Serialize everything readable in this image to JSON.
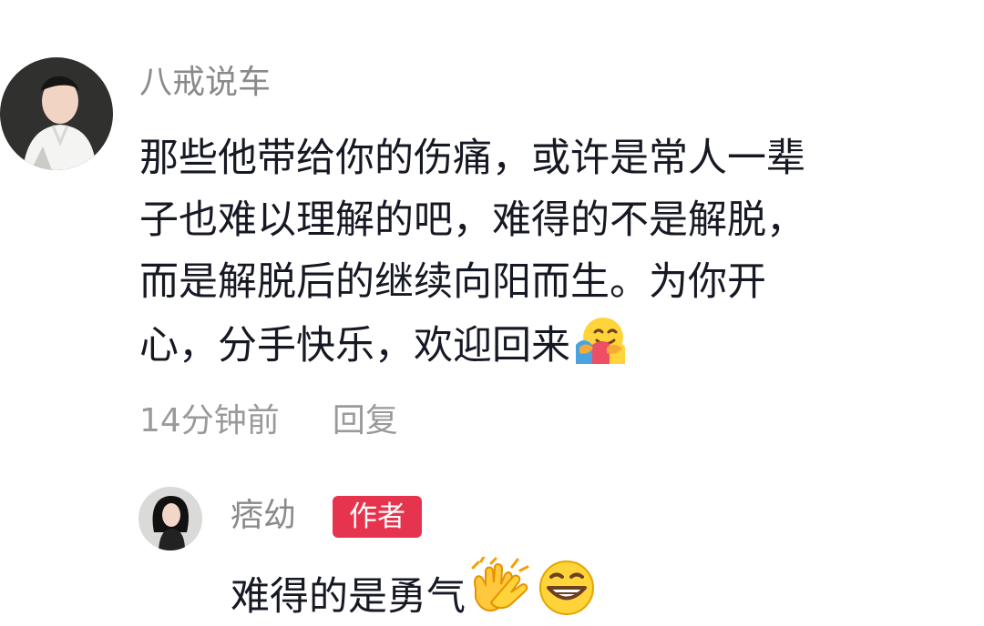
{
  "comment": {
    "username": "八戒说车",
    "lines": [
      "那些他带给你的伤痛，或许是常人一辈",
      "子也难以理解的吧，难得的不是解脱，",
      "而是解脱后的继续向阳而生。为你开",
      "心，分手快乐，欢迎回来"
    ],
    "emoji": "hugging-face-icon",
    "time": "14分钟前",
    "reply_label": "回复"
  },
  "reply": {
    "username": "痞幼",
    "badge": "作者",
    "text": "难得的是勇气",
    "emojis": [
      "clapping-hands-icon",
      "grinning-face-icon"
    ]
  },
  "colors": {
    "text": "#161823",
    "muted": "#8a8a8a",
    "badge": "#e7344e",
    "background": "#ffffff"
  }
}
